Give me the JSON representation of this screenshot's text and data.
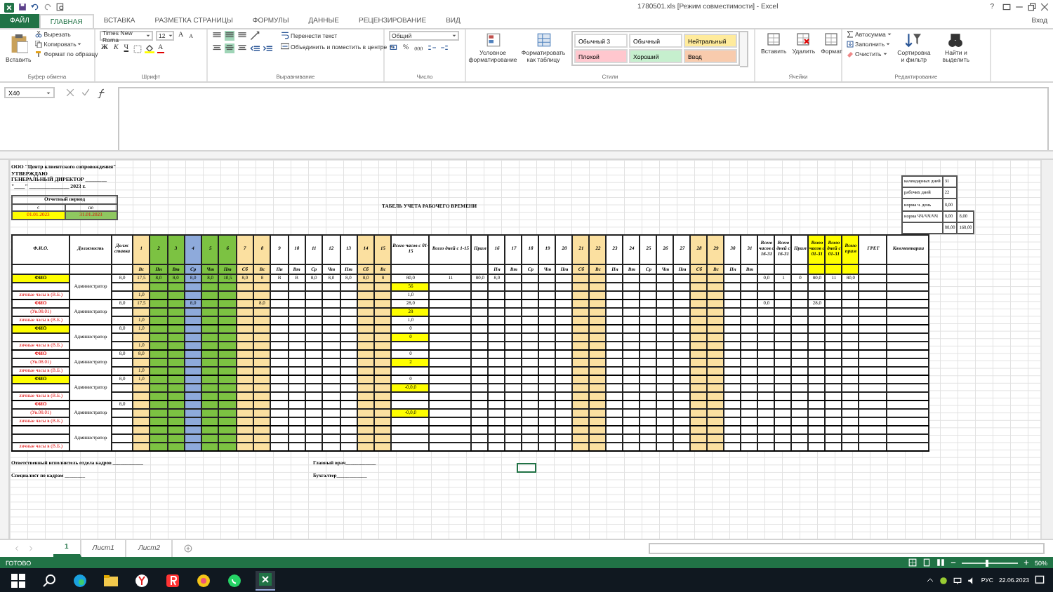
{
  "window": {
    "title": "1780501.xls [Режим совместимости] - Excel",
    "help": "?",
    "sign_in": "Вход"
  },
  "tabs": [
    {
      "label": "ФАЙЛ",
      "kind": "file",
      "selected": false
    },
    {
      "label": "ГЛАВНАЯ",
      "kind": "tab",
      "selected": true
    },
    {
      "label": "ВСТАВКА",
      "kind": "tab",
      "selected": false
    },
    {
      "label": "РАЗМЕТКА СТРАНИЦЫ",
      "kind": "tab",
      "selected": false
    },
    {
      "label": "ФОРМУЛЫ",
      "kind": "tab",
      "selected": false
    },
    {
      "label": "ДАННЫЕ",
      "kind": "tab",
      "selected": false
    },
    {
      "label": "РЕЦЕНЗИРОВАНИЕ",
      "kind": "tab",
      "selected": false
    },
    {
      "label": "ВИД",
      "kind": "tab",
      "selected": false
    }
  ],
  "ribbon": [
    {
      "kind": "clipboard",
      "caption": "Буфер обмена",
      "paste": "Вставить",
      "items": [
        "Вырезать",
        "Копировать",
        "Формат по образцу"
      ]
    },
    {
      "kind": "font",
      "caption": "Шрифт",
      "font_name": "Times New Roma",
      "font_size": "12",
      "grow": "A",
      "shrink": "A",
      "bold": "Ж",
      "italic": "К",
      "underline": "Ч",
      "font_color": "A"
    },
    {
      "kind": "alignment",
      "caption": "Выравнивание",
      "wrap": "Перенести текст",
      "merge": "Объединить и поместить в центре"
    },
    {
      "kind": "number",
      "caption": "Число",
      "format": "Общий",
      "percent": "%",
      "thousands": "000"
    },
    {
      "kind": "styles",
      "caption": "Стили",
      "buttons": [
        "Условное форматирование",
        "Форматировать как таблицу"
      ],
      "styles": [
        {
          "label": "Обычный 3",
          "color": "#ffffff"
        },
        {
          "label": "Обычный",
          "color": "#ffffff"
        },
        {
          "label": "Нейтральный",
          "color": "#ffeb9c"
        },
        {
          "label": "Плохой",
          "color": "#ffc7ce"
        },
        {
          "label": "Хороший",
          "color": "#c6efce"
        },
        {
          "label": "Ввод",
          "color": "#f8cbad"
        }
      ]
    },
    {
      "kind": "cells",
      "caption": "Ячейки",
      "buttons": [
        "Вставить",
        "Удалить",
        "Формат"
      ]
    },
    {
      "kind": "editing",
      "caption": "Редактирование",
      "items": [
        "Автосумма",
        "Заполнить",
        "Очистить"
      ],
      "buttons": [
        "Сортировка и фильтр",
        "Найти и выделить"
      ]
    }
  ],
  "formula_bar": {
    "name_box": "X40"
  },
  "sheet": {
    "org": "ООО \"Центр клиентского сопровождения\"",
    "approve": "УТВЕРЖДАЮ",
    "director": "ГЕНЕРАЛЬНЫЙ  ДИРЕКТОР ________",
    "date_line": "\"____\" _______________ 2023 г.",
    "period": {
      "title": "Отчетный период",
      "from_label": "с",
      "to_label": "по",
      "from": "01.01.2023",
      "to": "31.01.2023"
    },
    "title": "ТАБЕЛЬ УЧЕТА РАБОЧЕГО ВРЕМЕНИ",
    "summary": [
      {
        "label": "календарных дней",
        "values": [
          "31"
        ]
      },
      {
        "label": "рабочих дней",
        "values": [
          "22"
        ]
      },
      {
        "label": "норма ч. день",
        "values": [
          "8,00"
        ]
      },
      {
        "label": "норма ЧЧ/ЧЧ/ЧЧ",
        "values": [
          "8,00",
          "8,00"
        ]
      },
      {
        "values": [
          "88,00",
          "168,00"
        ]
      }
    ],
    "headers": {
      "name": "Ф.И.О.",
      "position": "Должность",
      "rate": "Долж ставка",
      "total1": "Всего часов с 01-15",
      "days1": "Всего дней с 1-15",
      "prim1": "Прим",
      "total2": "Всего часов с 16-31",
      "days2": "Всего дней с 16-31",
      "prim2": "Прим",
      "total": "Всего часов с 01-31",
      "days": "Всего дней с 01-31",
      "prim": "Всего прим",
      "col_x": "ГРЕТ",
      "comments": "Комментарии"
    },
    "days": [
      {
        "day": "1",
        "weekday": "Вс",
        "color": "#fbe0a0"
      },
      {
        "day": "2",
        "weekday": "Пн",
        "color": "#7cc242"
      },
      {
        "day": "3",
        "weekday": "Вт",
        "color": "#7cc242"
      },
      {
        "day": "4",
        "weekday": "Ср",
        "color": "#8eaadb"
      },
      {
        "day": "5",
        "weekday": "Чт",
        "color": "#7cc242"
      },
      {
        "day": "6",
        "weekday": "Пт",
        "color": "#7cc242"
      },
      {
        "day": "7",
        "weekday": "Сб",
        "color": "#fbe0a0"
      },
      {
        "day": "8",
        "weekday": "Вс",
        "color": "#fbe0a0"
      },
      {
        "day": "9",
        "weekday": "Пн",
        "color": "#ffffff"
      },
      {
        "day": "10",
        "weekday": "Вт",
        "color": "#ffffff"
      },
      {
        "day": "11",
        "weekday": "Ср",
        "color": "#ffffff"
      },
      {
        "day": "12",
        "weekday": "Чт",
        "color": "#ffffff"
      },
      {
        "day": "13",
        "weekday": "Пт",
        "color": "#ffffff"
      },
      {
        "day": "14",
        "weekday": "Сб",
        "color": "#fbe0a0"
      },
      {
        "day": "15",
        "weekday": "Вс",
        "color": "#fbe0a0"
      },
      {
        "day": "16",
        "weekday": "Пн",
        "color": "#ffffff"
      },
      {
        "day": "17",
        "weekday": "Вт",
        "color": "#ffffff"
      },
      {
        "day": "18",
        "weekday": "Ср",
        "color": "#ffffff"
      },
      {
        "day": "19",
        "weekday": "Чт",
        "color": "#ffffff"
      },
      {
        "day": "20",
        "weekday": "Пт",
        "color": "#ffffff"
      },
      {
        "day": "21",
        "weekday": "Сб",
        "color": "#fbe0a0"
      },
      {
        "day": "22",
        "weekday": "Вс",
        "color": "#fbe0a0"
      },
      {
        "day": "23",
        "weekday": "Пн",
        "color": "#ffffff"
      },
      {
        "day": "24",
        "weekday": "Вт",
        "color": "#ffffff"
      },
      {
        "day": "25",
        "weekday": "Ср",
        "color": "#ffffff"
      },
      {
        "day": "26",
        "weekday": "Чт",
        "color": "#ffffff"
      },
      {
        "day": "27",
        "weekday": "Пт",
        "color": "#ffffff"
      },
      {
        "day": "28",
        "weekday": "Сб",
        "color": "#fbe0a0"
      },
      {
        "day": "29",
        "weekday": "Вс",
        "color": "#fbe0a0"
      },
      {
        "day": "30",
        "weekday": "Пн",
        "color": "#ffffff"
      },
      {
        "day": "31",
        "weekday": "Вт",
        "color": "#ffffff"
      }
    ],
    "employees": [
      {
        "name": "ФИО",
        "highlight": true,
        "hours_label": "личные часы в (В.Б.)",
        "position": "Администратор",
        "rate": "8,0",
        "hours": {
          "d1": "17,5",
          "d2": "8,0",
          "d3": "8,0",
          "d4": "8,0",
          "d5": "8,0",
          "d6": "10,5",
          "d7": "8,0",
          "d8": "8",
          "d9": "В",
          "d10": "В",
          "d11": "8,0",
          "d12": "8,0",
          "d13": "8,0",
          "d14": "8,0",
          "d15": "8",
          "d16": "8,0"
        },
        "extra": "1,0",
        "total1": "80,0",
        "flag": "56",
        "total1_extra": "1,0",
        "days1": "11",
        "prim1": "80,0",
        "total2": "0,0",
        "days2": "1",
        "prim2": "0",
        "total": "80,0",
        "days": "11",
        "prim": "80,0"
      },
      {
        "name": "ФИО",
        "highlight": false,
        "note": "(Ув.08.01)",
        "hours_label": "личные часы в (В.Б.)",
        "position": "Администратор",
        "rate": "8,0",
        "hours": {
          "d1": "17,5",
          "d4": "8,0",
          "d8": "8,0"
        },
        "extra": "1,0",
        "total1": "28,0",
        "flag": "28",
        "total1_extra": "1,0",
        "total2": "0,0",
        "total": "28,0"
      },
      {
        "name": "ФИО",
        "highlight": true,
        "hours_label": "личные часы в (В.Б.)",
        "position": "Администратор",
        "rate": "8,0",
        "hours": {
          "d1": "1,0"
        },
        "extra": "1,0",
        "total1": "0",
        "flag": "0"
      },
      {
        "name": "ФИО",
        "highlight": false,
        "note": "(Ув.08.01)",
        "hours_label": "личные часы в (В.Б.)",
        "position": "Администратор",
        "rate": "8,0",
        "hours": {
          "d1": "8,0"
        },
        "extra": "1,0",
        "total1": "0",
        "flag": "2"
      },
      {
        "name": "ФИО",
        "highlight": true,
        "hours_label": "личные часы в (В.Б.)",
        "position": "Администратор",
        "rate": "8,0",
        "hours": {
          "d1": "1,0"
        },
        "total1": "0",
        "flag": "-0,0,0"
      },
      {
        "name": "ФИО",
        "highlight": false,
        "note": "(Ув.08.01)",
        "hours_label": "личные часы в (В.Б.)",
        "position": "Администратор",
        "rate": "8,0",
        "flag": "-0,0,0"
      },
      {
        "highlight": false,
        "hours_label": "личные часы в (В.Б.)",
        "position": "Администратор"
      }
    ],
    "signatures": {
      "left": [
        "Ответственный исполнитель отдела кадров ____________",
        "Специалист по кадрам ________"
      ],
      "right": [
        "Главный врач____________",
        "Бухгалтер____________"
      ]
    }
  },
  "sheet_tabs": [
    {
      "label": "1",
      "selected": true
    },
    {
      "label": "Лист1",
      "selected": false
    },
    {
      "label": "Лист2",
      "selected": false
    }
  ],
  "status_bar": {
    "text": "ГОТОВО",
    "zoom": "50%",
    "level": 0.45
  },
  "taskbar": {
    "lang": "РУС",
    "date": "22.06.2023"
  }
}
